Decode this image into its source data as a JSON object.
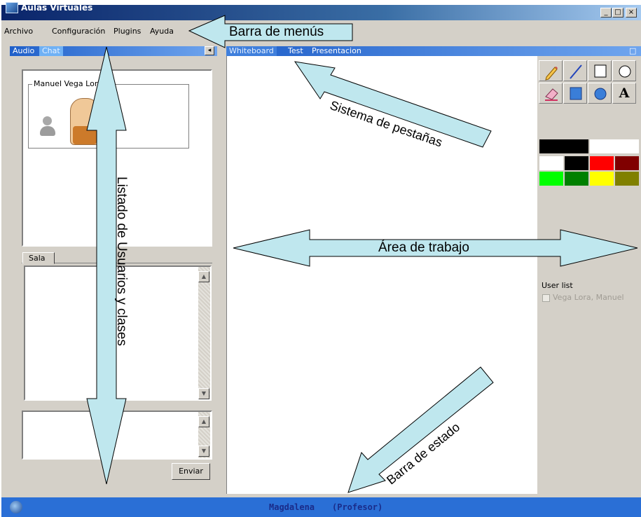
{
  "window": {
    "title": "Aulas Virtuales",
    "buttons": [
      "_",
      "□",
      "×"
    ]
  },
  "menu": [
    "Archivo",
    "Configuración",
    "Plugins",
    "Ayuda"
  ],
  "left_tabs": [
    "Audio",
    "Chat"
  ],
  "collapse_glyph": "◂",
  "user_box": {
    "group_label": "Manuel Vega Lora"
  },
  "sala_tab": "Sala",
  "scroll": {
    "up": "▲",
    "down": "▼"
  },
  "send_button": "Enviar",
  "main_tabs": [
    "Whiteboard",
    "Test",
    "Presentacion"
  ],
  "maximize_glyph": "□",
  "tools": [
    "pencil-tool",
    "line-tool",
    "rectangle-outline-tool",
    "ellipse-outline-tool",
    "eraser-tool",
    "filled-rectangle-tool",
    "filled-ellipse-tool",
    "text-tool"
  ],
  "text_tool_glyph": "A",
  "palette": {
    "current": [
      "#000000",
      "#ffffff"
    ],
    "swatches": [
      "#ffffff",
      "#000000",
      "#ff0000",
      "#800000",
      "#00ff00",
      "#008000",
      "#ffff00",
      "#808000"
    ]
  },
  "user_list": {
    "title": "User list",
    "users": [
      "Vega Lora, Manuel"
    ]
  },
  "status": {
    "user": "Magdalena",
    "role": "(Profesor)"
  },
  "callouts": {
    "menu_bar": "Barra de menús",
    "tabs": "Sistema de pestañas",
    "users": "Listado de Usuarios y clases",
    "work_area": "Área de trabajo",
    "status_bar": "Barra de estado"
  },
  "colors": {
    "callout_fill": "#bfe7ee",
    "titlebar": "#0a246a",
    "statusbar": "#2a6fd6"
  }
}
